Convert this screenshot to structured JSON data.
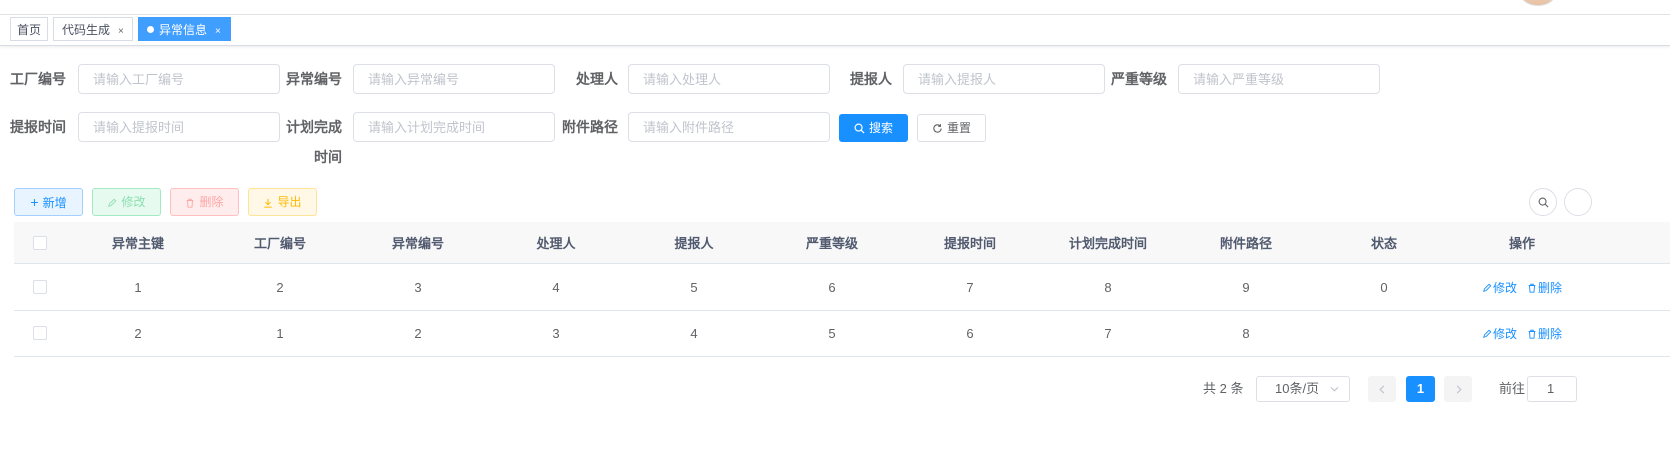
{
  "tags": [
    {
      "label": "首页"
    },
    {
      "label": "代码生成",
      "close": "×"
    },
    {
      "label": "异常信息",
      "close": "×"
    }
  ],
  "form": {
    "fields": [
      {
        "label": "工厂编号",
        "placeholder": "请输入工厂编号"
      },
      {
        "label": "异常编号",
        "placeholder": "请输入异常编号"
      },
      {
        "label": "处理人",
        "placeholder": "请输入处理人"
      },
      {
        "label": "提报人",
        "placeholder": "请输入提报人"
      },
      {
        "label": "严重等级",
        "placeholder": "请输入严重等级"
      },
      {
        "label": "提报时间",
        "placeholder": "请输入提报时间"
      },
      {
        "label_line1": "计划完成",
        "label_line2": "时间",
        "placeholder": "请输入计划完成时间"
      },
      {
        "label": "附件路径",
        "placeholder": "请输入附件路径"
      }
    ],
    "search_label": "搜索",
    "reset_label": "重置"
  },
  "toolbar": {
    "add_label": "新增",
    "edit_label": "修改",
    "delete_label": "删除",
    "export_label": "导出"
  },
  "table": {
    "columns": [
      "异常主键",
      "工厂编号",
      "异常编号",
      "处理人",
      "提报人",
      "严重等级",
      "提报时间",
      "计划完成时间",
      "附件路径",
      "状态",
      "操作"
    ],
    "rows": [
      [
        "1",
        "2",
        "3",
        "4",
        "5",
        "6",
        "7",
        "8",
        "9",
        "0"
      ],
      [
        "2",
        "1",
        "2",
        "3",
        "4",
        "5",
        "6",
        "7",
        "8",
        ""
      ]
    ],
    "row_edit_label": "修改",
    "row_delete_label": "删除"
  },
  "pagination": {
    "total_text": "共 2 条",
    "page_size": "10条/页",
    "current_page": "1",
    "goto_label": "前往",
    "goto_value": "1"
  },
  "colors": {
    "primary": "#1890ff",
    "tag_active": "#409eff"
  }
}
